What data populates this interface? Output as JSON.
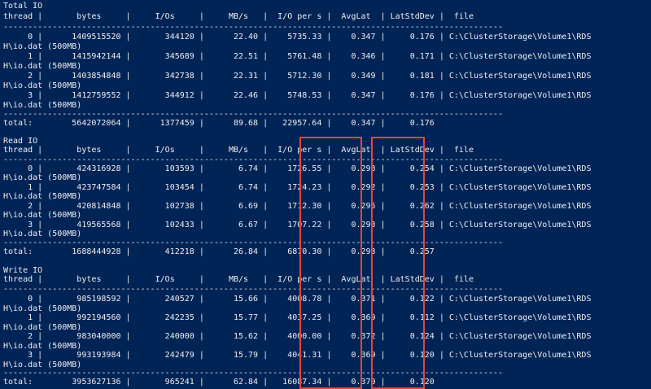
{
  "colors": {
    "background": "#012456",
    "foreground": "#eeedf0",
    "highlight": "#e0473e"
  },
  "console": {
    "lines": [
      "Total IO",
      "thread |       bytes     |     I/Os     |     MB/s   |  I/O per s |  AvgLat  | LatStdDev |  file",
      "------------------------------------------------------------------------------------------------------",
      "     0 |      1409515520 |       344120 |      22.40 |    5735.33 |    0.347 |     0.176 | C:\\ClusterStorage\\Volume1\\RDS",
      "H\\io.dat (500MB)",
      "     1 |      1415942144 |       345689 |      22.51 |    5761.48 |    0.346 |     0.171 | C:\\ClusterStorage\\Volume1\\RDS",
      "H\\io.dat (500MB)",
      "     2 |      1403854848 |       342738 |      22.31 |    5712.30 |    0.349 |     0.181 | C:\\ClusterStorage\\Volume1\\RDS",
      "H\\io.dat (500MB)",
      "     3 |      1412759552 |       344912 |      22.46 |    5748.53 |    0.347 |     0.176 | C:\\ClusterStorage\\Volume1\\RDS",
      "H\\io.dat (500MB)",
      "------------------------------------------------------------------------------------------------------",
      "total:        5642072064 |      1377459 |      89.68 |   22957.64 |    0.347 |     0.176",
      "",
      "Read IO",
      "thread |       bytes     |     I/Os     |     MB/s   |  I/O per s |  AvgLat  | LatStdDev |  file",
      "------------------------------------------------------------------------------------------------------",
      "     0 |       424316928 |       103593 |       6.74 |    1726.55 |    0.293 |     0.254 | C:\\ClusterStorage\\Volume1\\RDS",
      "H\\io.dat (500MB)",
      "     1 |       423747584 |       103454 |       6.74 |    1724.23 |    0.292 |     0.253 | C:\\ClusterStorage\\Volume1\\RDS",
      "H\\io.dat (500MB)",
      "     2 |       420814848 |       102738 |       6.69 |    1712.30 |    0.295 |     0.262 | C:\\ClusterStorage\\Volume1\\RDS",
      "H\\io.dat (500MB)",
      "     3 |       419565568 |       102433 |       6.67 |    1707.22 |    0.293 |     0.258 | C:\\ClusterStorage\\Volume1\\RDS",
      "H\\io.dat (500MB)",
      "------------------------------------------------------------------------------------------------------",
      "total:        1688444928 |       412218 |      26.84 |    6870.30 |    0.293 |     0.257",
      "",
      "Write IO",
      "thread |       bytes     |     I/Os     |     MB/s   |  I/O per s |  AvgLat  | LatStdDev |  file",
      "------------------------------------------------------------------------------------------------------",
      "     0 |       985198592 |       240527 |      15.66 |    4008.78 |    0.371 |     0.122 | C:\\ClusterStorage\\Volume1\\RDS",
      "H\\io.dat (500MB)",
      "     1 |       992194560 |       242235 |      15.77 |    4037.25 |    0.369 |     0.112 | C:\\ClusterStorage\\Volume1\\RDS",
      "H\\io.dat (500MB)",
      "     2 |       983040000 |       240000 |      15.62 |    4000.00 |    0.372 |     0.124 | C:\\ClusterStorage\\Volume1\\RDS",
      "H\\io.dat (500MB)",
      "     3 |       993193984 |       242479 |      15.79 |    4041.31 |    0.369 |     0.120 | C:\\ClusterStorage\\Volume1\\RDS",
      "H\\io.dat (500MB)",
      "------------------------------------------------------------------------------------------------------",
      "total:        3953627136 |       965241 |      62.84 |   16087.34 |    0.370 |     0.120"
    ]
  }
}
